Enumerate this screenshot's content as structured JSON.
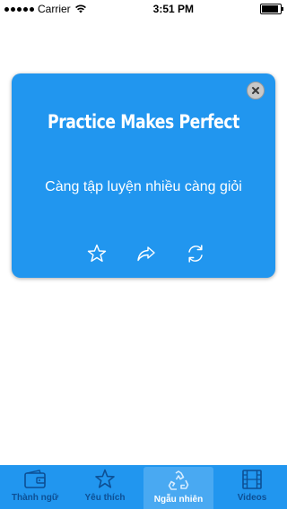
{
  "status_bar": {
    "carrier": "Carrier",
    "time": "3:51 PM",
    "battery_level": 0.9
  },
  "card": {
    "title": "Practice Makes Perfect",
    "translation": "Càng tập luyện nhiều càng giỏi",
    "actions": {
      "favorite_icon": "star-icon",
      "share_icon": "share-icon",
      "refresh_icon": "refresh-icon",
      "close_icon": "close-icon"
    }
  },
  "tab_bar": {
    "tabs": [
      {
        "label": "Thành ngữ",
        "icon": "wallet-icon",
        "active": false
      },
      {
        "label": "Yêu thích",
        "icon": "star-icon",
        "active": false
      },
      {
        "label": "Ngẫu nhiên",
        "icon": "recycle-icon",
        "active": true
      },
      {
        "label": "Videos",
        "icon": "film-icon",
        "active": false
      }
    ]
  },
  "colors": {
    "accent": "#2196ef",
    "tab_inactive_text": "#0d4f94",
    "tab_active_text": "#ffffff"
  }
}
